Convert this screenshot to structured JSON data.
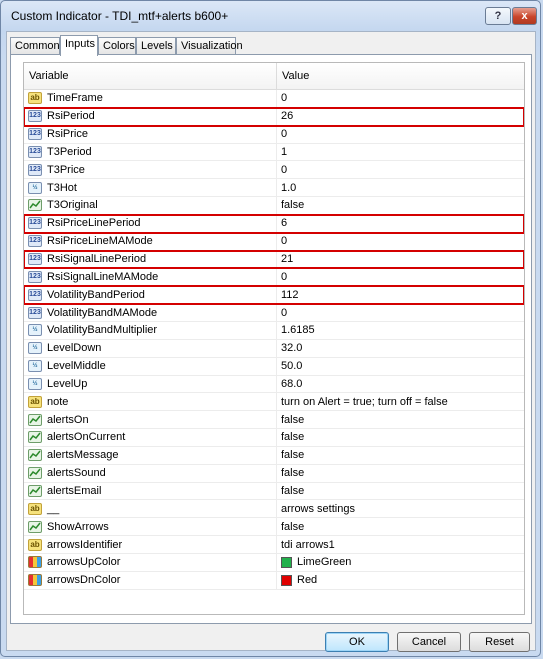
{
  "window": {
    "title": "Custom Indicator - TDI_mtf+alerts b600+",
    "help_label": "?",
    "close_label": "x"
  },
  "tabs": [
    {
      "label": "Common",
      "active": false
    },
    {
      "label": "Inputs",
      "active": true
    },
    {
      "label": "Colors",
      "active": false
    },
    {
      "label": "Levels",
      "active": false
    },
    {
      "label": "Visualization",
      "active": false
    }
  ],
  "grid": {
    "headers": {
      "variable": "Variable",
      "value": "Value"
    },
    "rows": [
      {
        "icon": "string-icon",
        "icon_text": "ab",
        "name": "TimeFrame",
        "value": "0",
        "highlight": false
      },
      {
        "icon": "integer-icon",
        "icon_text": "123",
        "name": "RsiPeriod",
        "value": "26",
        "highlight": true
      },
      {
        "icon": "integer-icon",
        "icon_text": "123",
        "name": "RsiPrice",
        "value": "0",
        "highlight": false
      },
      {
        "icon": "integer-icon",
        "icon_text": "123",
        "name": "T3Period",
        "value": "1",
        "highlight": false
      },
      {
        "icon": "integer-icon",
        "icon_text": "123",
        "name": "T3Price",
        "value": "0",
        "highlight": false
      },
      {
        "icon": "double-icon",
        "icon_text": "½",
        "name": "T3Hot",
        "value": "1.0",
        "highlight": false
      },
      {
        "icon": "boolean-icon",
        "icon_text": "",
        "name": "T3Original",
        "value": "false",
        "highlight": false
      },
      {
        "icon": "integer-icon",
        "icon_text": "123",
        "name": "RsiPriceLinePeriod",
        "value": "6",
        "highlight": true
      },
      {
        "icon": "integer-icon",
        "icon_text": "123",
        "name": "RsiPriceLineMAMode",
        "value": "0",
        "highlight": false
      },
      {
        "icon": "integer-icon",
        "icon_text": "123",
        "name": "RsiSignalLinePeriod",
        "value": "21",
        "highlight": true
      },
      {
        "icon": "integer-icon",
        "icon_text": "123",
        "name": "RsiSignalLineMAMode",
        "value": "0",
        "highlight": false
      },
      {
        "icon": "integer-icon",
        "icon_text": "123",
        "name": "VolatilityBandPeriod",
        "value": "112",
        "highlight": true
      },
      {
        "icon": "integer-icon",
        "icon_text": "123",
        "name": "VolatilityBandMAMode",
        "value": "0",
        "highlight": false
      },
      {
        "icon": "double-icon",
        "icon_text": "½",
        "name": "VolatilityBandMultiplier",
        "value": "1.6185",
        "highlight": false
      },
      {
        "icon": "double-icon",
        "icon_text": "½",
        "name": "LevelDown",
        "value": "32.0",
        "highlight": false
      },
      {
        "icon": "double-icon",
        "icon_text": "½",
        "name": "LevelMiddle",
        "value": "50.0",
        "highlight": false
      },
      {
        "icon": "double-icon",
        "icon_text": "½",
        "name": "LevelUp",
        "value": "68.0",
        "highlight": false
      },
      {
        "icon": "string-icon",
        "icon_text": "ab",
        "name": "note",
        "value": "turn on Alert = true; turn off = false",
        "highlight": false
      },
      {
        "icon": "boolean-icon",
        "icon_text": "",
        "name": "alertsOn",
        "value": "false",
        "highlight": false
      },
      {
        "icon": "boolean-icon",
        "icon_text": "",
        "name": "alertsOnCurrent",
        "value": "false",
        "highlight": false
      },
      {
        "icon": "boolean-icon",
        "icon_text": "",
        "name": "alertsMessage",
        "value": "false",
        "highlight": false
      },
      {
        "icon": "boolean-icon",
        "icon_text": "",
        "name": "alertsSound",
        "value": "false",
        "highlight": false
      },
      {
        "icon": "boolean-icon",
        "icon_text": "",
        "name": "alertsEmail",
        "value": "false",
        "highlight": false
      },
      {
        "icon": "string-icon",
        "icon_text": "ab",
        "name": "__",
        "value": "arrows settings",
        "highlight": false
      },
      {
        "icon": "boolean-icon",
        "icon_text": "",
        "name": "ShowArrows",
        "value": "false",
        "highlight": false
      },
      {
        "icon": "string-icon",
        "icon_text": "ab",
        "name": "arrowsIdentifier",
        "value": "tdi arrows1",
        "highlight": false
      },
      {
        "icon": "color-icon",
        "icon_text": "",
        "name": "arrowsUpColor",
        "value": "LimeGreen",
        "swatch": "#22b14c",
        "highlight": false
      },
      {
        "icon": "color-icon",
        "icon_text": "",
        "name": "arrowsDnColor",
        "value": "Red",
        "swatch": "#e00000",
        "highlight": false
      }
    ]
  },
  "buttons": {
    "ok": "OK",
    "cancel": "Cancel",
    "reset": "Reset"
  },
  "colors": {
    "highlight_border": "#d40000"
  }
}
